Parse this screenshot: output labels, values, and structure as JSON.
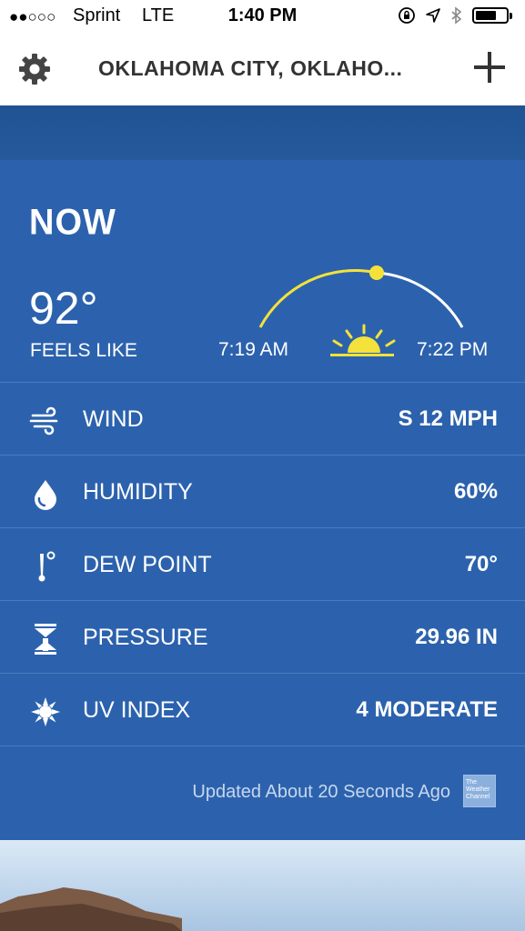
{
  "status_bar": {
    "signal": "●●○○○",
    "carrier": "Sprint",
    "network": "LTE",
    "time": "1:40 PM"
  },
  "header": {
    "title": "OKLAHOMA CITY, OKLAHO..."
  },
  "now": {
    "title": "NOW",
    "temperature": "92°",
    "feels_like_label": "FEELS LIKE",
    "sunrise": "7:19 AM",
    "sunset": "7:22 PM"
  },
  "conditions": [
    {
      "label": "WIND",
      "value": "S 12 MPH",
      "icon": "wind-icon"
    },
    {
      "label": "HUMIDITY",
      "value": "60%",
      "icon": "droplet-icon"
    },
    {
      "label": "DEW POINT",
      "value": "70°",
      "icon": "thermometer-icon"
    },
    {
      "label": "PRESSURE",
      "value": "29.96 IN",
      "icon": "pressure-icon"
    },
    {
      "label": "UV INDEX",
      "value": "4 MODERATE",
      "icon": "sun-burst-icon"
    }
  ],
  "footer": {
    "updated": "Updated About 20 Seconds Ago",
    "logo_text": "The Weather Channel"
  },
  "colors": {
    "panel": "#2c62ad",
    "sun": "#f4e23b",
    "accent_text": "#ffffff"
  }
}
